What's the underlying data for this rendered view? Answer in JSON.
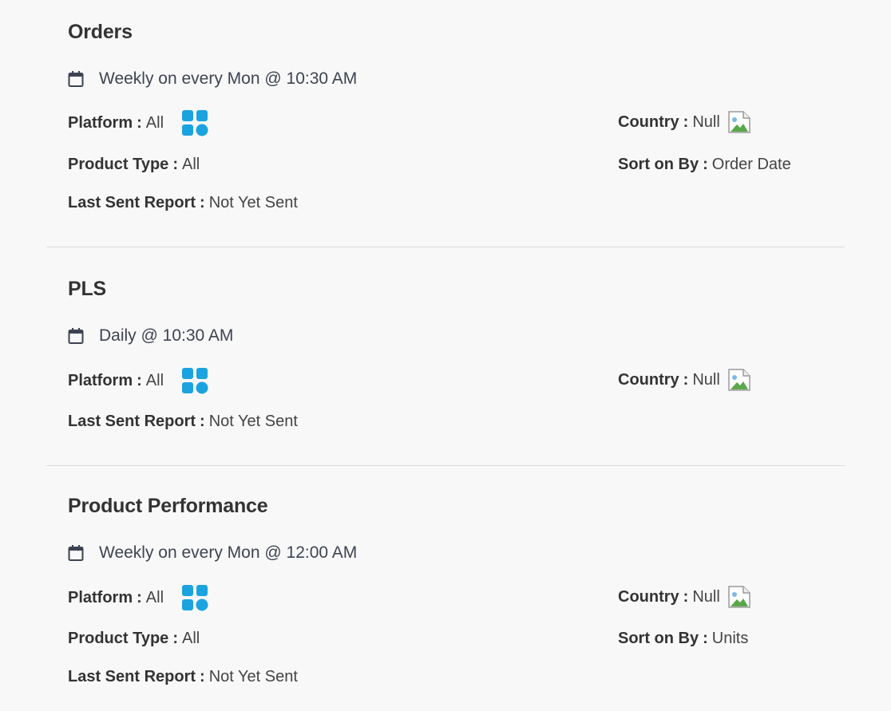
{
  "reports": [
    {
      "title": "Orders",
      "schedule": "Weekly on every Mon @ 10:30 AM",
      "platform": {
        "label": "Platform",
        "value": "All"
      },
      "country": {
        "label": "Country",
        "value": "Null"
      },
      "product_type": {
        "label": "Product Type",
        "value": "All"
      },
      "sort_on": {
        "label": "Sort on By",
        "value": "Order Date"
      },
      "last_sent": {
        "label": "Last Sent Report",
        "value": "Not Yet Sent"
      }
    },
    {
      "title": "PLS",
      "schedule": "Daily @ 10:30 AM",
      "platform": {
        "label": "Platform",
        "value": "All"
      },
      "country": {
        "label": "Country",
        "value": "Null"
      },
      "last_sent": {
        "label": "Last Sent Report",
        "value": "Not Yet Sent"
      }
    },
    {
      "title": "Product Performance",
      "schedule": "Weekly on every Mon @ 12:00 AM",
      "platform": {
        "label": "Platform",
        "value": "All"
      },
      "country": {
        "label": "Country",
        "value": "Null"
      },
      "product_type": {
        "label": "Product Type",
        "value": "All"
      },
      "sort_on": {
        "label": "Sort on By",
        "value": "Units"
      },
      "last_sent": {
        "label": "Last Sent Report",
        "value": "Not Yet Sent"
      }
    }
  ],
  "separator": ":",
  "icons": {
    "schedule": "calendar-icon",
    "platform": "all-platforms-grid-icon",
    "country": "broken-image-icon"
  },
  "colors": {
    "platform_icon": "#1ba3e0",
    "calendar_icon": "#3d4451"
  }
}
